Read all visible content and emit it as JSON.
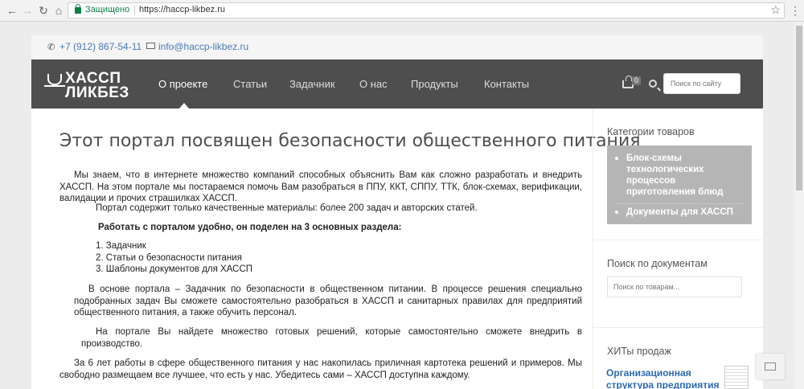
{
  "browser": {
    "secure_label": "Защищено",
    "url": "https://haccp-likbez.ru"
  },
  "topbar": {
    "phone": "+7 (912) 867-54-11",
    "email": "info@haccp-likbez.ru"
  },
  "header": {
    "logo_line1": "ХАССП",
    "logo_line2": "ЛИКБЕЗ",
    "menu": [
      "О проекте",
      "Статьи",
      "Задачник",
      "О нас",
      "Продукты",
      "Контакты"
    ],
    "cart_count": "0",
    "search_placeholder": "Поиск по сайту"
  },
  "main": {
    "title": "Этот портал посвящен безопасности общественного питания",
    "p1": "Мы знаем, что в интернете множество компаний способных объяснить Вам как сложно разработать и внедрить ХАССП. На этом портале мы постараемся помочь Вам разобраться в ППУ, ККТ, СППУ, ТТК, блок-схемах, верификации, валидации и прочих страшилках ХАССП.",
    "p2": "Портал содержит только качественные материалы: более 200 задач и авторских статей.",
    "p3": "Работать с порталом удобно, он поделен на 3 основных раздела:",
    "list": [
      "1. Задачник",
      "2. Статьи о безопасности питания",
      "3. Шаблоны документов для ХАССП"
    ],
    "p4": "В основе портала – Задачник по безопасности в общественном питании. В процессе решения специально подобранных задач Вы сможете самостоятельно разобраться в ХАССП и санитарных правилах для предприятий общественного питания, а также обучить персонал.",
    "p5": "На портале Вы найдете множество готовых решений, которые самостоятельно сможете внедрить в производство.",
    "p6": "За 6 лет работы в сфере общественного питания у нас накопилась приличная картотека решений и примеров. Мы свободно размещаем все лучшее, что есть у нас. Убедитесь сами – ХАССП доступна каждому."
  },
  "sidebar": {
    "categories_title": "Категории товаров",
    "categories": [
      "Блок-схемы технологических процессов приготовления блюд",
      "Документы для ХАССП"
    ],
    "doc_search_title": "Поиск по документам",
    "doc_search_placeholder": "Поиск по товарам...",
    "hits_title": "ХИТы продаж",
    "hit_item": "Организационная структура предприятия"
  }
}
